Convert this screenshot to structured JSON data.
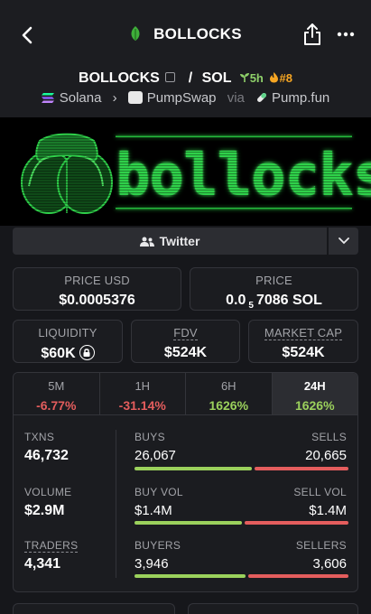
{
  "header": {
    "title": "BOLLOCKS"
  },
  "pair": {
    "base": "BOLLOCKS",
    "separator": "/",
    "quote": "SOL",
    "age": "5h",
    "rank": "#8",
    "chain": "Solana",
    "dex": "PumpSwap",
    "via_label": "via",
    "launchpad": "Pump.fun"
  },
  "banner": {
    "word": "bollocks"
  },
  "social": {
    "twitter_label": "Twitter"
  },
  "metrics": {
    "price_usd_label": "PRICE USD",
    "price_usd": "$0.0005376",
    "price_label": "PRICE",
    "price_prefix": "0.0",
    "price_zeros": "5",
    "price_suffix": "7086 SOL",
    "liquidity_label": "LIQUIDITY",
    "liquidity": "$60K",
    "fdv_label": "FDV",
    "fdv": "$524K",
    "mcap_label": "MARKET CAP",
    "mcap": "$524K"
  },
  "timeframes": [
    {
      "label": "5M",
      "change": "-6.77%",
      "color": "#e45d5d"
    },
    {
      "label": "1H",
      "change": "-31.14%",
      "color": "#e45d5d"
    },
    {
      "label": "6H",
      "change": "1626%",
      "color": "#9bd15c"
    },
    {
      "label": "24H",
      "change": "1626%",
      "color": "#9bd15c"
    }
  ],
  "stats": {
    "txns_label": "TXNS",
    "txns": "46,732",
    "buys_label": "BUYS",
    "buys": "26,067",
    "sells_label": "SELLS",
    "sells": "20,665",
    "volume_label": "VOLUME",
    "volume": "$2.9M",
    "buy_vol_label": "BUY VOL",
    "buy_vol": "$1.4M",
    "sell_vol_label": "SELL VOL",
    "sell_vol": "$1.4M",
    "traders_label": "TRADERS",
    "traders": "4,341",
    "buyers_label": "BUYERS",
    "buyers": "3,946",
    "sellers_label": "SELLERS",
    "sellers": "3,606"
  },
  "colors": {
    "positive": "#9bd15c",
    "negative": "#e45d5d",
    "banner_green": "#2fd14a"
  }
}
